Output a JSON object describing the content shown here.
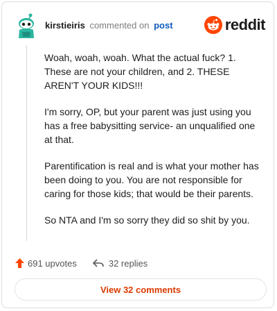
{
  "header": {
    "username": "kirstieiris",
    "action_text": "commented on",
    "post_link": "post",
    "brand": "reddit"
  },
  "comment": {
    "paragraphs": [
      "Woah, woah, woah. What the actual fuck? 1. These are not your children, and 2. THESE AREN'T YOUR KIDS!!!",
      "I'm sorry, OP, but your parent was just using you has a free babysitting service- an unqualified one at that.",
      "Parentification is real and is what your mother has been doing to you. You are not responsible for caring for those kids; that would be their parents.",
      "So NTA and I'm so sorry they did so shit by you."
    ]
  },
  "footer": {
    "upvotes": "691 upvotes",
    "replies": "32 replies"
  },
  "view_button": "View 32 comments",
  "colors": {
    "brand_orange": "#ff4500",
    "link_blue": "#0d5bbd",
    "button_text": "#d93a00",
    "avatar_green": "#2bb5a0"
  },
  "icons": [
    "avatar-icon",
    "reddit-logo-icon",
    "upvote-icon",
    "reply-icon"
  ]
}
